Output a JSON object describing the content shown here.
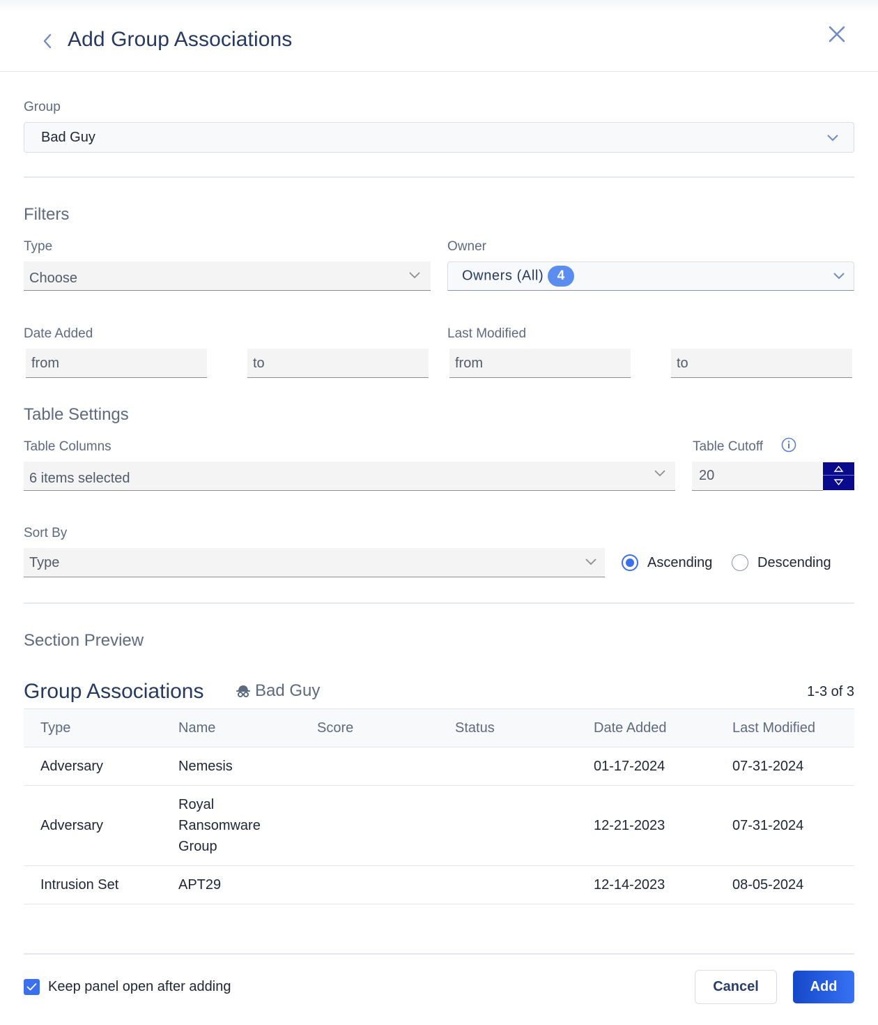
{
  "header": {
    "title": "Add Group Associations",
    "back_icon": "chevron-left-icon",
    "close_icon": "close-icon"
  },
  "group": {
    "label": "Group",
    "value": "Bad Guy"
  },
  "filters": {
    "title": "Filters",
    "type": {
      "label": "Type",
      "value": "Choose"
    },
    "owner": {
      "label": "Owner",
      "value": "Owners (All)",
      "badge": "4"
    },
    "date_added": {
      "label": "Date Added",
      "from_placeholder": "from",
      "to_placeholder": "to"
    },
    "last_modified": {
      "label": "Last Modified",
      "from_placeholder": "from",
      "to_placeholder": "to"
    }
  },
  "table_settings": {
    "title": "Table Settings",
    "columns": {
      "label": "Table Columns",
      "value": "6 items selected"
    },
    "cutoff": {
      "label": "Table Cutoff",
      "value": "20",
      "info_icon": "info-icon"
    },
    "sort_by": {
      "label": "Sort By",
      "value": "Type"
    },
    "order": {
      "ascending": "Ascending",
      "descending": "Descending",
      "selected": "ascending"
    }
  },
  "preview": {
    "title": "Section Preview",
    "table_title": "Group Associations",
    "group_name": "Bad Guy",
    "group_icon": "spy-icon",
    "count": "1-3 of 3",
    "columns": [
      "Type",
      "Name",
      "Score",
      "Status",
      "Date Added",
      "Last Modified"
    ],
    "rows": [
      {
        "type": "Adversary",
        "name": "Nemesis",
        "score": "",
        "status": "",
        "date_added": "01-17-2024",
        "last_modified": "07-31-2024"
      },
      {
        "type": "Adversary",
        "name": "Royal Ransomware Group",
        "score": "",
        "status": "",
        "date_added": "12-21-2023",
        "last_modified": "07-31-2024"
      },
      {
        "type": "Intrusion Set",
        "name": "APT29",
        "score": "",
        "status": "",
        "date_added": "12-14-2023",
        "last_modified": "08-05-2024"
      }
    ]
  },
  "footer": {
    "keep_open_label": "Keep panel open after adding",
    "keep_open_checked": true,
    "cancel_label": "Cancel",
    "add_label": "Add"
  },
  "colors": {
    "primary": "#3a6ff0",
    "title": "#263a61",
    "stepper": "#0a0a8c",
    "badge": "#5b8cf0"
  }
}
